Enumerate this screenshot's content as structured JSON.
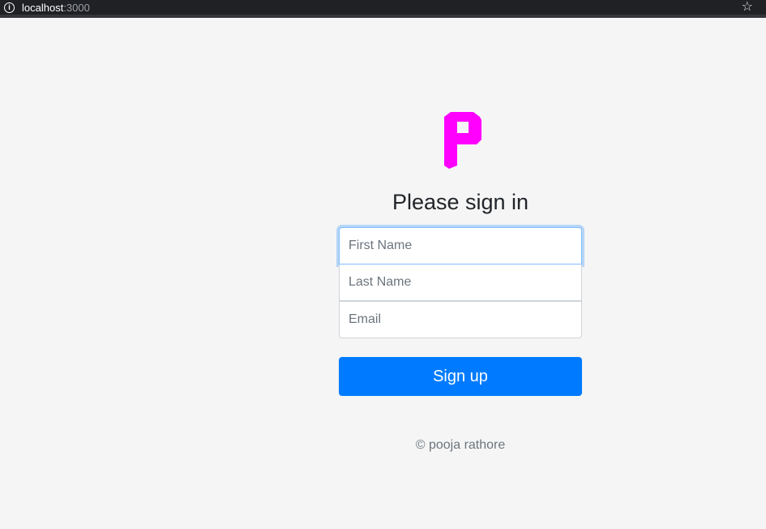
{
  "browser": {
    "host": "localhost",
    "port": ":3000",
    "info_icon": "info-icon",
    "bookmark_icon": "star-icon"
  },
  "logo": {
    "icon": "letter-p-logo",
    "color": "#ff00ff"
  },
  "form": {
    "heading": "Please sign in",
    "first_name_placeholder": "First Name",
    "last_name_placeholder": "Last Name",
    "email_placeholder": "Email",
    "submit_label": "Sign up",
    "accent_color": "#007bff"
  },
  "footer": {
    "text": "© pooja rathore"
  }
}
